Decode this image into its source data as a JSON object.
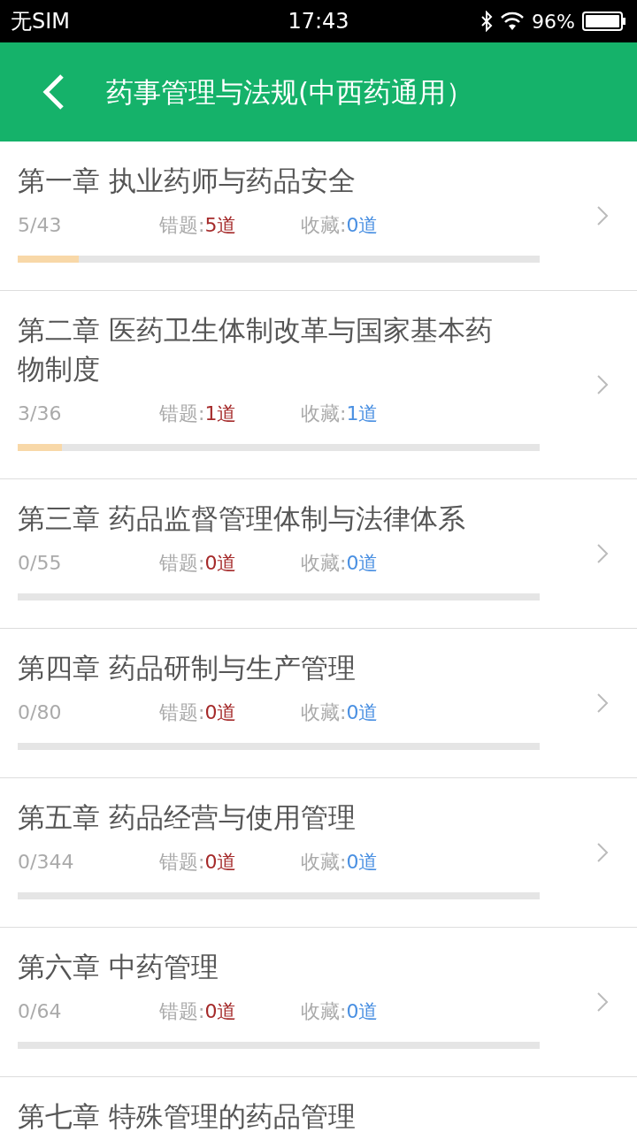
{
  "status_bar": {
    "carrier": "无SIM",
    "time": "17:43",
    "battery": "96%"
  },
  "header": {
    "title": "药事管理与法规(中西药通用）"
  },
  "chapters": [
    {
      "title": "第一章 执业药师与药品安全",
      "progress": "5/43",
      "wrong_label": "错题:",
      "wrong_value": "5道",
      "fav_label": "收藏:",
      "fav_value": "0道",
      "level": 0.117
    },
    {
      "title": "第二章 医药卫生体制改革与国家基本药物制度",
      "progress": "3/36",
      "wrong_label": "错题:",
      "wrong_value": "1道",
      "fav_label": "收藏:",
      "fav_value": "1道",
      "level": 0.085
    },
    {
      "title": "第三章 药品监督管理体制与法律体系",
      "progress": "0/55",
      "wrong_label": "错题:",
      "wrong_value": "0道",
      "fav_label": "收藏:",
      "fav_value": "0道"
    },
    {
      "title": "第四章 药品研制与生产管理",
      "progress": "0/80",
      "wrong_label": "错题:",
      "wrong_value": "0道",
      "fav_label": "收藏:",
      "fav_value": "0道"
    },
    {
      "title": "第五章 药品经营与使用管理",
      "progress": "0/344",
      "wrong_label": "错题:",
      "wrong_value": "0道",
      "fav_label": "收藏:",
      "fav_value": "0道"
    },
    {
      "title": "第六章 中药管理",
      "progress": "0/64",
      "wrong_label": "错题:",
      "wrong_value": "0道",
      "fav_label": "收藏:",
      "fav_value": "0道"
    },
    {
      "title": "第七章 特殊管理的药品管理"
    }
  ]
}
